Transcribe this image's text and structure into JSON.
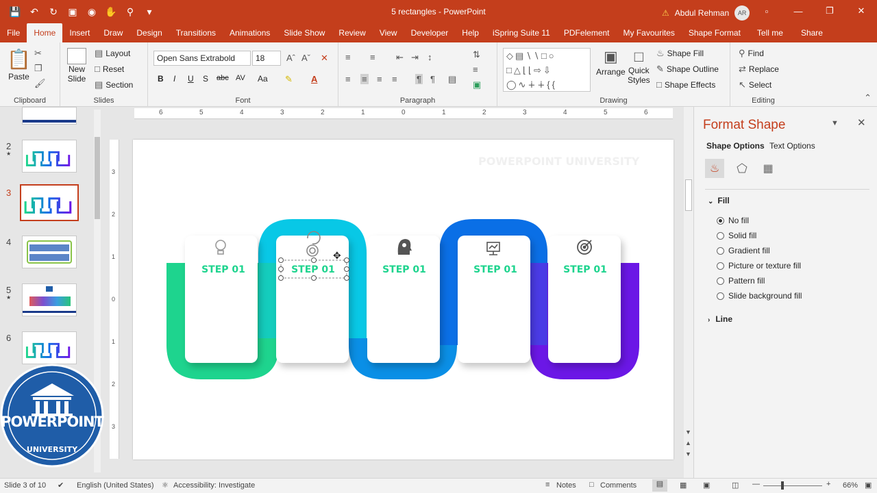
{
  "app": {
    "doc_title": "5 rectangles",
    "app_name": "PowerPoint",
    "title_sep": "-",
    "user_name": "Abdul Rehman",
    "user_initials": "AR"
  },
  "tabs": [
    "File",
    "Home",
    "Insert",
    "Draw",
    "Design",
    "Transitions",
    "Animations",
    "Slide Show",
    "Review",
    "View",
    "Developer",
    "Help",
    "iSpring Suite 11",
    "PDFelement",
    "My Favourites",
    "Shape Format",
    "Tell me",
    "Share"
  ],
  "active_tab": "Home",
  "ribbon": {
    "clipboard": {
      "label": "Clipboard",
      "paste": "Paste"
    },
    "slides": {
      "label": "Slides",
      "new_slide": "New",
      "new_slide2": "Slide",
      "layout": "Layout",
      "reset": "Reset",
      "section": "Section"
    },
    "font": {
      "label": "Font",
      "font_name": "Open Sans Extrabold",
      "font_size": "18",
      "bold": "B",
      "italic": "I",
      "underline": "U",
      "strike": "S",
      "abc": "abc",
      "av": "AV",
      "aa": "Aa"
    },
    "paragraph": {
      "label": "Paragraph"
    },
    "drawing": {
      "label": "Drawing",
      "arrange": "Arrange",
      "quick_styles": "Quick",
      "quick_styles2": "Styles",
      "shape_fill": "Shape Fill",
      "shape_outline": "Shape Outline",
      "shape_effects": "Shape Effects"
    },
    "editing": {
      "label": "Editing",
      "find": "Find",
      "replace": "Replace",
      "select": "Select"
    }
  },
  "thumbnails": [
    {
      "num": "2",
      "star": "★"
    },
    {
      "num": "3",
      "star": ""
    },
    {
      "num": "4",
      "star": ""
    },
    {
      "num": "5",
      "star": "★"
    },
    {
      "num": "6",
      "star": ""
    }
  ],
  "logo": {
    "line1": "POWERPOINT",
    "line2": "UNIVERSITY"
  },
  "slide": {
    "watermark": "POWERPOINT UNIVERSITY",
    "steps": [
      "STEP 01",
      "STEP 01",
      "STEP 01",
      "STEP 01",
      "STEP 01"
    ],
    "colors": {
      "green": "#1ed48e",
      "cyan": "#08c8e6",
      "blue": "#0a6fe6",
      "purple": "#6b17e6"
    },
    "icons": [
      "lightbulb-icon",
      "target-rotate-icon",
      "head-gear-icon",
      "presentation-icon",
      "bullseye-icon"
    ]
  },
  "ruler_h": [
    "6",
    "5",
    "4",
    "3",
    "2",
    "1",
    "0",
    "1",
    "2",
    "3",
    "4",
    "5",
    "6"
  ],
  "ruler_v": [
    "3",
    "2",
    "1",
    "0",
    "1",
    "2",
    "3"
  ],
  "format_pane": {
    "title": "Format Shape",
    "tab_shape": "Shape Options",
    "tab_text": "Text Options",
    "fill_header": "Fill",
    "fill_options": [
      "No fill",
      "Solid fill",
      "Gradient fill",
      "Picture or texture fill",
      "Pattern fill",
      "Slide background fill"
    ],
    "selected_fill": "No fill",
    "line_header": "Line"
  },
  "status": {
    "slide_info": "Slide 3 of 10",
    "language": "English (United States)",
    "accessibility": "Accessibility: Investigate",
    "notes": "Notes",
    "comments": "Comments",
    "zoom": "66%"
  }
}
